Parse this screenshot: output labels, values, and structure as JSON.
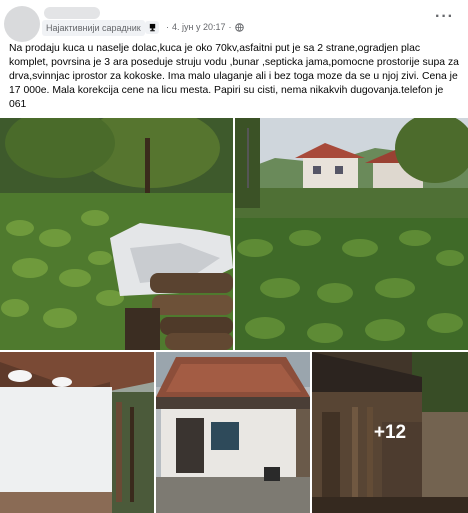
{
  "post": {
    "author_badge": "Најактивнији сарадник",
    "date": "4. јун у 20:17",
    "separator": "·",
    "text": "Na prodaju kuca u naselje dolac,kuca je oko 70kv,asfaitni put je sa 2 strane,ogradjen plac komplet, povrsina je 3 ara poseduje struju vodu ,bunar ,septicka jama,pomocne prostorije supa za drva,svinnjac iprostor za kokoske. Ima  malo ulaganje ali i bez toga moze da se u njoj zivi. Cena je 17 000e. Mala korekcija cene na licu mesta. Papiri su cisti, nema nikakvih dugovanja.telefon je  061",
    "more_photos": "+12"
  },
  "icons": {
    "options": "more-options-icon",
    "badge": "award-icon",
    "audience": "globe-icon"
  },
  "colors": {
    "secondary_text": "#65676b",
    "primary_text": "#050505"
  }
}
